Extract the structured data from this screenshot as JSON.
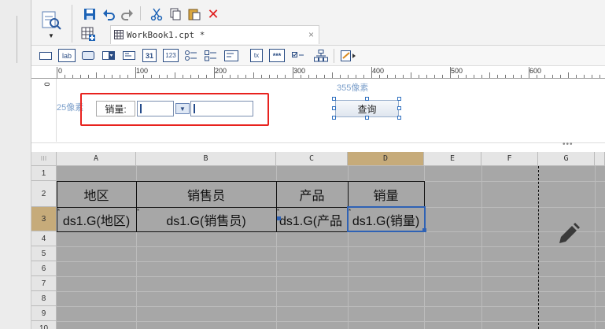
{
  "toolbar": {
    "icons": [
      "preview-icon",
      "save-icon",
      "undo-icon",
      "redo-icon",
      "cut-icon",
      "copy-icon",
      "paste-icon",
      "delete-icon"
    ],
    "colors": {
      "save": "#1d63b6",
      "undo": "#1d63b6",
      "redo": "#888888",
      "cut": "#1d63b6",
      "delete": "#e02020"
    }
  },
  "tab": {
    "title": "WorkBook1.cpt *",
    "close": "×"
  },
  "widgets": [
    "label-widget",
    "text-widget",
    "button-widget",
    "combo-widget",
    "date-widget",
    "calendar-widget",
    "number-widget",
    "radio-group-widget",
    "checkbox-group-widget",
    "tree-widget",
    "multi-file-widget",
    "password-widget",
    "checkbox-widget",
    "tree-combo-widget",
    "custom-widget"
  ],
  "widget_glyphs": {
    "lab": "lab",
    "calendar": "31",
    "number": "123",
    "text_icon": "tx",
    "password": "***"
  },
  "ruler": {
    "labels": [
      "0",
      "100",
      "200",
      "300",
      "400",
      "500",
      "600"
    ],
    "vlabel": "0"
  },
  "form": {
    "left_px_label": "25像素",
    "top_px_label": "355像素",
    "param_label": "销量:",
    "query_button": "查询"
  },
  "grid": {
    "columns": [
      "A",
      "B",
      "C",
      "D",
      "E",
      "F",
      "G"
    ],
    "selected_col": "D",
    "rows": [
      "1",
      "2",
      "3",
      "4",
      "5",
      "6",
      "7",
      "8",
      "9",
      "10"
    ],
    "selected_row": "3",
    "header_row": [
      "地区",
      "销售员",
      "产品",
      "销量"
    ],
    "data_row": [
      "ds1.G(地区)",
      "ds1.G(销售员)",
      "ds1.G(产品",
      "ds1.G(销量)"
    ]
  }
}
